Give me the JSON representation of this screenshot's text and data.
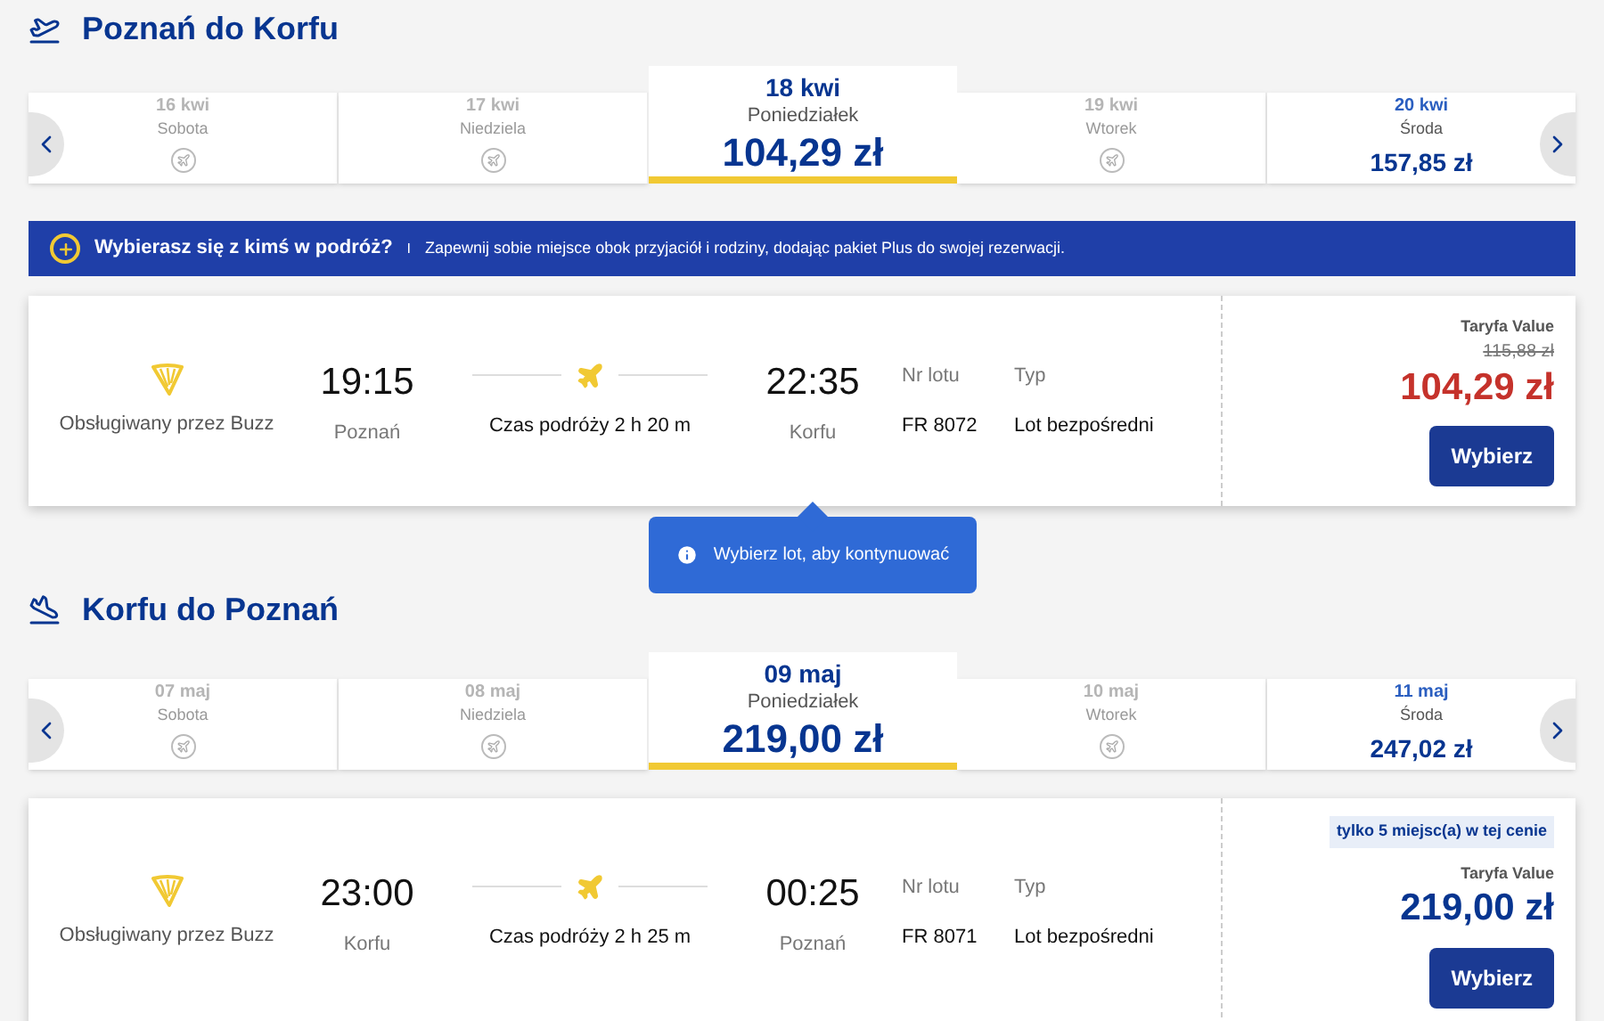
{
  "banner": {
    "title": "Wybierasz się z kimś w podróż?",
    "separator": "I",
    "text": "Zapewnij sobie miejsce obok przyjaciół i rodziny, dodając pakiet Plus do swojej rezerwacji."
  },
  "tooltip": {
    "text": "Wybierz lot, aby kontynuować"
  },
  "sections": [
    {
      "kind": "outbound",
      "title": "Poznań do Korfu",
      "dates": [
        {
          "date": "16 kwi",
          "day": "Sobota",
          "selected": false
        },
        {
          "date": "17 kwi",
          "day": "Niedziela",
          "selected": false
        },
        {
          "date": "18 kwi",
          "day": "Poniedziałek",
          "price": "104,29 zł",
          "selected": true
        },
        {
          "date": "19 kwi",
          "day": "Wtorek",
          "selected": false
        },
        {
          "date": "20 kwi",
          "day": "Środa",
          "price": "157,85 zł",
          "selected": false
        }
      ],
      "flight": {
        "operator": "Obsługiwany przez Buzz",
        "dep_time": "19:15",
        "dep_city": "Poznań",
        "duration": "Czas podróży 2 h 20 m",
        "arr_time": "22:35",
        "arr_city": "Korfu",
        "flight_no_label": "Nr lotu",
        "flight_no": "FR 8072",
        "type_label": "Typ",
        "type": "Lot bezpośredni",
        "fare": "Taryfa Value",
        "old_price": "115,88 zł",
        "price": "104,29 zł",
        "button": "Wybierz"
      }
    },
    {
      "kind": "inbound",
      "title": "Korfu do Poznań",
      "dates": [
        {
          "date": "07 maj",
          "day": "Sobota",
          "selected": false
        },
        {
          "date": "08 maj",
          "day": "Niedziela",
          "selected": false
        },
        {
          "date": "09 maj",
          "day": "Poniedziałek",
          "price": "219,00 zł",
          "selected": true
        },
        {
          "date": "10 maj",
          "day": "Wtorek",
          "selected": false
        },
        {
          "date": "11 maj",
          "day": "Środa",
          "price": "247,02 zł",
          "selected": false
        }
      ],
      "flight": {
        "badge": "tylko 5 miejsc(a) w tej cenie",
        "operator": "Obsługiwany przez Buzz",
        "dep_time": "23:00",
        "dep_city": "Korfu",
        "duration": "Czas podróży 2 h 25 m",
        "arr_time": "00:25",
        "arr_city": "Poznań",
        "flight_no_label": "Nr lotu",
        "flight_no": "FR 8071",
        "type_label": "Typ",
        "type": "Lot bezpośredni",
        "fare": "Taryfa Value",
        "price": "219,00 zł",
        "button": "Wybierz"
      }
    }
  ]
}
